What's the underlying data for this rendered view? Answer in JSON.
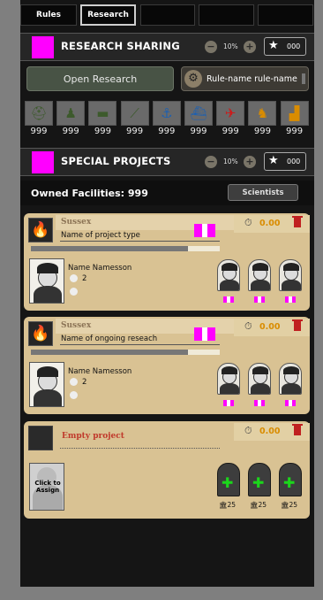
{
  "tabs": [
    "Rules",
    "Research",
    "",
    "",
    ""
  ],
  "research_sharing": {
    "title": "RESEARCH SHARING",
    "pct": "10%",
    "stars": "000",
    "open_label": "Open Research",
    "rule_label": "Rule-name rule-name",
    "units": [
      {
        "icon": "helmet-icon",
        "glyph": "⛑",
        "color": "#3d5a2c",
        "count": "999"
      },
      {
        "icon": "soldier-icon",
        "glyph": "♟",
        "color": "#3d5a2c",
        "count": "999"
      },
      {
        "icon": "tank-icon",
        "glyph": "▬",
        "color": "#3d5a2c",
        "count": "999"
      },
      {
        "icon": "artillery-icon",
        "glyph": "⟋",
        "color": "#3d5a2c",
        "count": "999"
      },
      {
        "icon": "anchor-icon",
        "glyph": "⚓",
        "color": "#1e60b0",
        "count": "999"
      },
      {
        "icon": "ship-icon",
        "glyph": "⛴",
        "color": "#1e60b0",
        "count": "999"
      },
      {
        "icon": "plane-icon",
        "glyph": "✈",
        "color": "#cc1a1a",
        "count": "999"
      },
      {
        "icon": "dog-icon",
        "glyph": "♞",
        "color": "#d98c00",
        "count": "999"
      },
      {
        "icon": "factory-icon",
        "glyph": "▟",
        "color": "#d98c00",
        "count": "999"
      }
    ]
  },
  "special_projects": {
    "title": "SPECIAL PROJECTS",
    "pct": "10%",
    "stars": "000"
  },
  "owned": {
    "label": "Owned Facilities: 999",
    "scientists_label": "Scientists"
  },
  "projects": [
    {
      "site": "Sussex",
      "type": "Name of project type",
      "time": "0.00",
      "progress": 0.83,
      "scientist": "Name Namesson",
      "level": "2"
    },
    {
      "site": "Sussex",
      "type": "Name of ongoing reseach",
      "time": "0.00",
      "progress": 0.83,
      "scientist": "Name Namesson",
      "level": "2"
    }
  ],
  "empty_project": {
    "label": "Empty project",
    "time": "0.00",
    "click_text": "Click to\nAssign",
    "costs": [
      "25",
      "25",
      "25"
    ]
  }
}
